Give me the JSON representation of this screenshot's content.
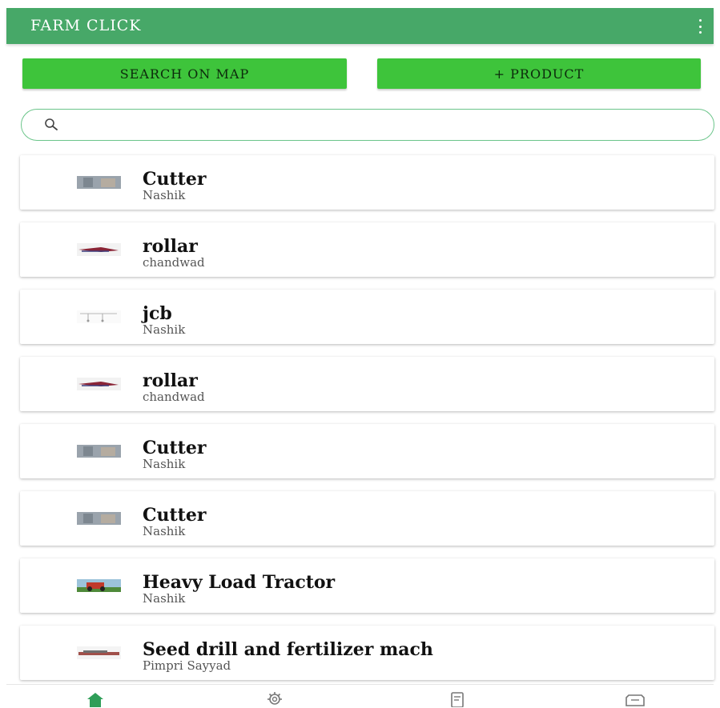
{
  "appbar": {
    "title": "FARM CLICK",
    "menu_icon": "more-vert-icon",
    "color": "#47a868"
  },
  "actions": {
    "search_map_label": "SEARCH ON MAP",
    "add_product_label": "+ PRODUCT",
    "button_color": "#3ec43b"
  },
  "search": {
    "placeholder": "",
    "value": "",
    "icon": "search-icon"
  },
  "products": [
    {
      "name": "Cutter",
      "location": "Nashik",
      "thumb": "cutter"
    },
    {
      "name": "rollar",
      "location": "chandwad",
      "thumb": "rollar"
    },
    {
      "name": "jcb",
      "location": "Nashik",
      "thumb": "jcb"
    },
    {
      "name": "rollar",
      "location": "chandwad",
      "thumb": "rollar"
    },
    {
      "name": "Cutter",
      "location": "Nashik",
      "thumb": "cutter"
    },
    {
      "name": "Cutter",
      "location": "Nashik",
      "thumb": "cutter"
    },
    {
      "name": "Heavy Load Tractor",
      "location": "Nashik",
      "thumb": "tractor"
    },
    {
      "name": "Seed drill and fertilizer mach",
      "location": "Pimpri Sayyad",
      "thumb": "seeddrill"
    }
  ],
  "bottom_nav": [
    {
      "icon": "home-icon",
      "active": true
    },
    {
      "icon": "settings-icon",
      "active": false
    },
    {
      "icon": "document-icon",
      "active": false
    },
    {
      "icon": "ticket-icon",
      "active": false
    }
  ]
}
